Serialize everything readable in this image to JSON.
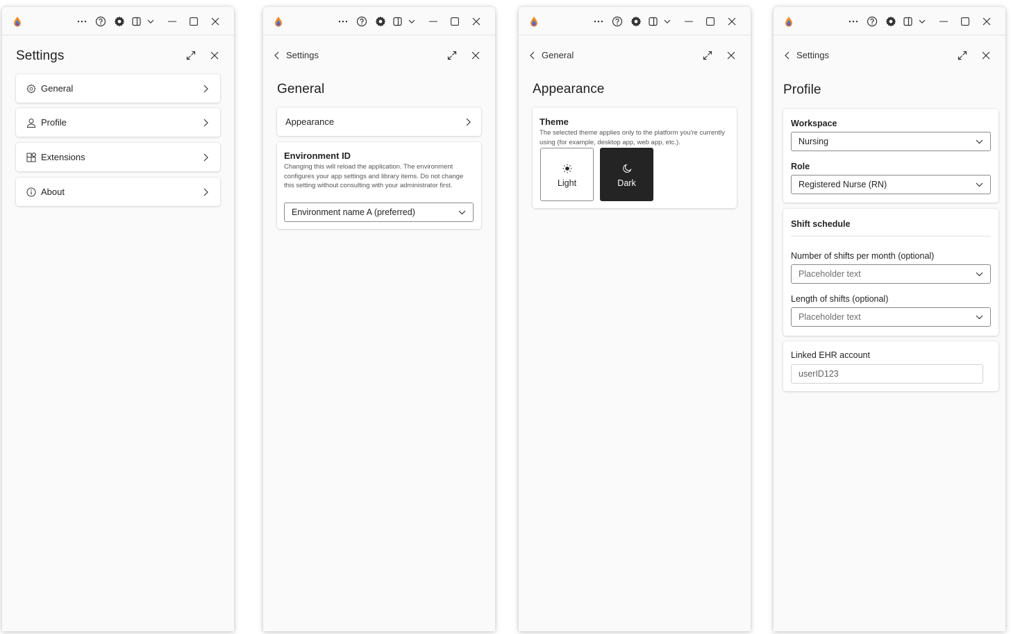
{
  "windows": [
    {
      "title": "Settings",
      "nav_items": [
        {
          "label": "General",
          "icon": "gear-icon"
        },
        {
          "label": "Profile",
          "icon": "person-icon"
        },
        {
          "label": "Extensions",
          "icon": "extensions-icon"
        },
        {
          "label": "About",
          "icon": "info-icon"
        }
      ]
    },
    {
      "back_label": "Settings",
      "title": "General",
      "appearance_label": "Appearance",
      "environment": {
        "title": "Environment ID",
        "description": "Changing this will reload the application. The environment configures your app settings and library items. Do not change this setting without consulting with your administrator first.",
        "selected": "Environment name A (preferred)"
      }
    },
    {
      "back_label": "General",
      "title": "Appearance",
      "theme": {
        "title": "Theme",
        "description": "The selected theme applies only to the platform you're currently using (for example, desktop app, web app, etc.).",
        "options": [
          {
            "label": "Light",
            "icon": "sun-icon"
          },
          {
            "label": "Dark",
            "icon": "moon-icon"
          }
        ],
        "selected": "Dark"
      }
    },
    {
      "back_label": "Settings",
      "title": "Profile",
      "workspace": {
        "label": "Workspace",
        "value": "Nursing"
      },
      "role": {
        "label": "Role",
        "value": "Registered Nurse (RN)"
      },
      "shift": {
        "title": "Shift schedule",
        "shifts_per_month": {
          "label": "Number of shifts per month (optional)",
          "placeholder": "Placeholder text"
        },
        "shift_length": {
          "label": "Length of shifts (optional)",
          "placeholder": "Placeholder text"
        }
      },
      "ehr": {
        "label": "Linked EHR account",
        "value": "userID123"
      }
    }
  ],
  "colors": {
    "background": "#fafafa",
    "card": "#ffffff",
    "dark_theme": "#242424"
  }
}
